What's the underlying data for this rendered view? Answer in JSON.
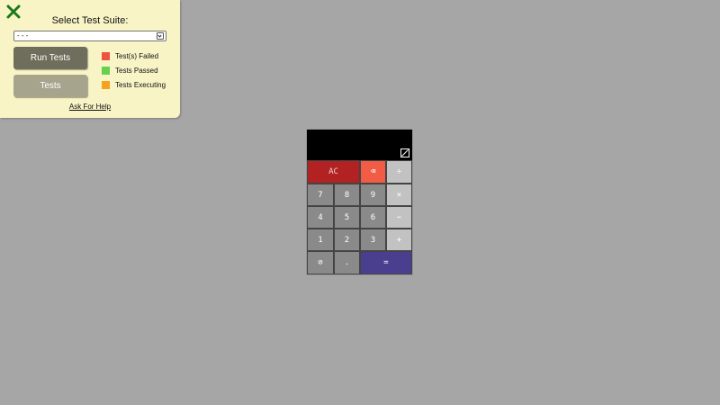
{
  "panel": {
    "close_icon": "close-x-icon",
    "suite_label": "Select Test Suite:",
    "suite_selected": "- - -",
    "run_tests_label": "Run Tests",
    "tests_label": "Tests",
    "legend": [
      {
        "label": "Test(s) Failed",
        "color": "#f05242"
      },
      {
        "label": "Tests Passed",
        "color": "#66d14f"
      },
      {
        "label": "Tests Executing",
        "color": "#f5a21d"
      }
    ],
    "help_label": "Ask For Help"
  },
  "calculator": {
    "display_value": "",
    "display_icon": "sign-toggle-icon",
    "keys": {
      "ac": "AC",
      "backspace": "⌫",
      "divide": "÷",
      "seven": "7",
      "eight": "8",
      "nine": "9",
      "multiply": "×",
      "four": "4",
      "five": "5",
      "six": "6",
      "minus": "−",
      "one": "1",
      "two": "2",
      "three": "3",
      "plus": "+",
      "sign": "⊘",
      "dot": ".",
      "equals": "="
    }
  }
}
